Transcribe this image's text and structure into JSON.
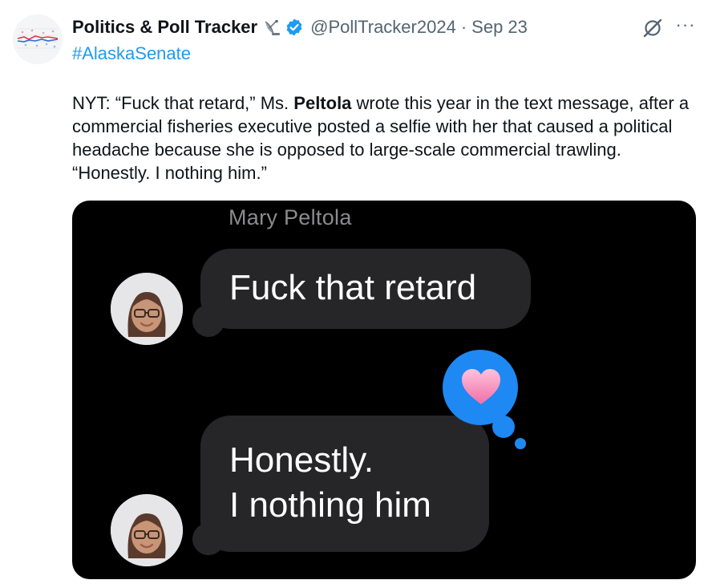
{
  "author": {
    "name": "Politics & Poll Tracker",
    "emoji_icon": "satellite-antenna-icon",
    "verified_icon": "verified-badge-icon",
    "handle": "@PollTracker2024",
    "separator": "·",
    "date": "Sep 23"
  },
  "actions": {
    "grok_icon": "grok-icon",
    "more_label": "···"
  },
  "tweet": {
    "hashtag": "#AlaskaSenate",
    "text_before": "NYT: “Fuck that retard,” Ms. ",
    "text_bold": "Peltola",
    "text_after": " wrote this year in the text message, after a commercial fisheries executive posted a selfie with her that caused a political headache because she is opposed to large-scale commercial trawling. “Honestly. I nothing him.”"
  },
  "media": {
    "sender_name": "Mary Peltola",
    "message_1": "Fuck that retard",
    "message_2_line_1": "Honestly.",
    "message_2_line_2": "I nothing him",
    "reaction_icon": "heart-icon",
    "colors": {
      "background": "#000000",
      "bubble": "#262629",
      "reaction": "#1e88f3",
      "link": "#1d9bf0"
    }
  }
}
